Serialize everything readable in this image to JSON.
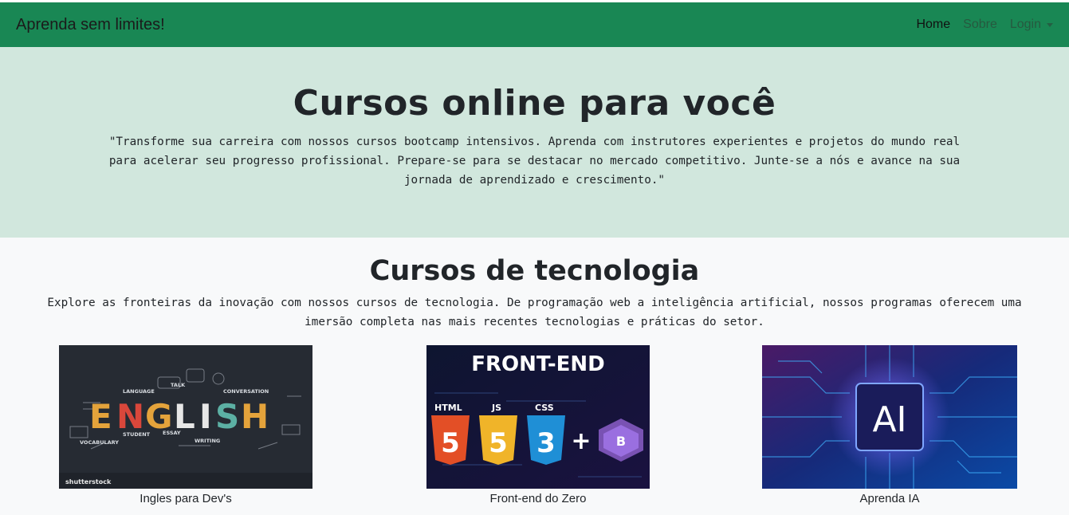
{
  "navbar": {
    "brand": "Aprenda sem limites!",
    "links": [
      "Home",
      "Sobre",
      "Login"
    ],
    "colors": {
      "background": "#198754"
    }
  },
  "hero": {
    "title": "Cursos online para você",
    "text": "\"Transforme sua carreira com nossos cursos bootcamp intensivos. Aprenda com instrutores experientes e projetos do mundo real para acelerar seu progresso profissional. Prepare-se para se destacar no mercado competitivo. Junte-se a nós e avance na sua jornada de aprendizado e crescimento.\"",
    "background": "#d1e7dd"
  },
  "section": {
    "title": "Cursos de tecnologia",
    "text": "Explore as fronteiras da inovação com nossos cursos de tecnologia. De programação web a inteligência artificial, nossos programas oferecem uma imersão completa nas mais recentes tecnologias e práticas do setor."
  },
  "courses": [
    {
      "caption": "Ingles para Dev's",
      "image": {
        "letters": [
          "E",
          "N",
          "G",
          "L",
          "I",
          "S",
          "H"
        ],
        "words": [
          "LANGUAGE",
          "TALK",
          "CONVERSATION",
          "VOCABULARY",
          "STUDENT",
          "ESSAY",
          "WRITING"
        ],
        "watermark": "shutterstock"
      }
    },
    {
      "caption": "Front-end do Zero",
      "image": {
        "title": "FRONT-END",
        "labels": [
          "HTML",
          "JS",
          "CSS"
        ],
        "badges": [
          "5",
          "5",
          "3",
          "B"
        ],
        "plus": "+"
      }
    },
    {
      "caption": "Aprenda IA",
      "image": {
        "chip_text": "AI"
      }
    }
  ]
}
